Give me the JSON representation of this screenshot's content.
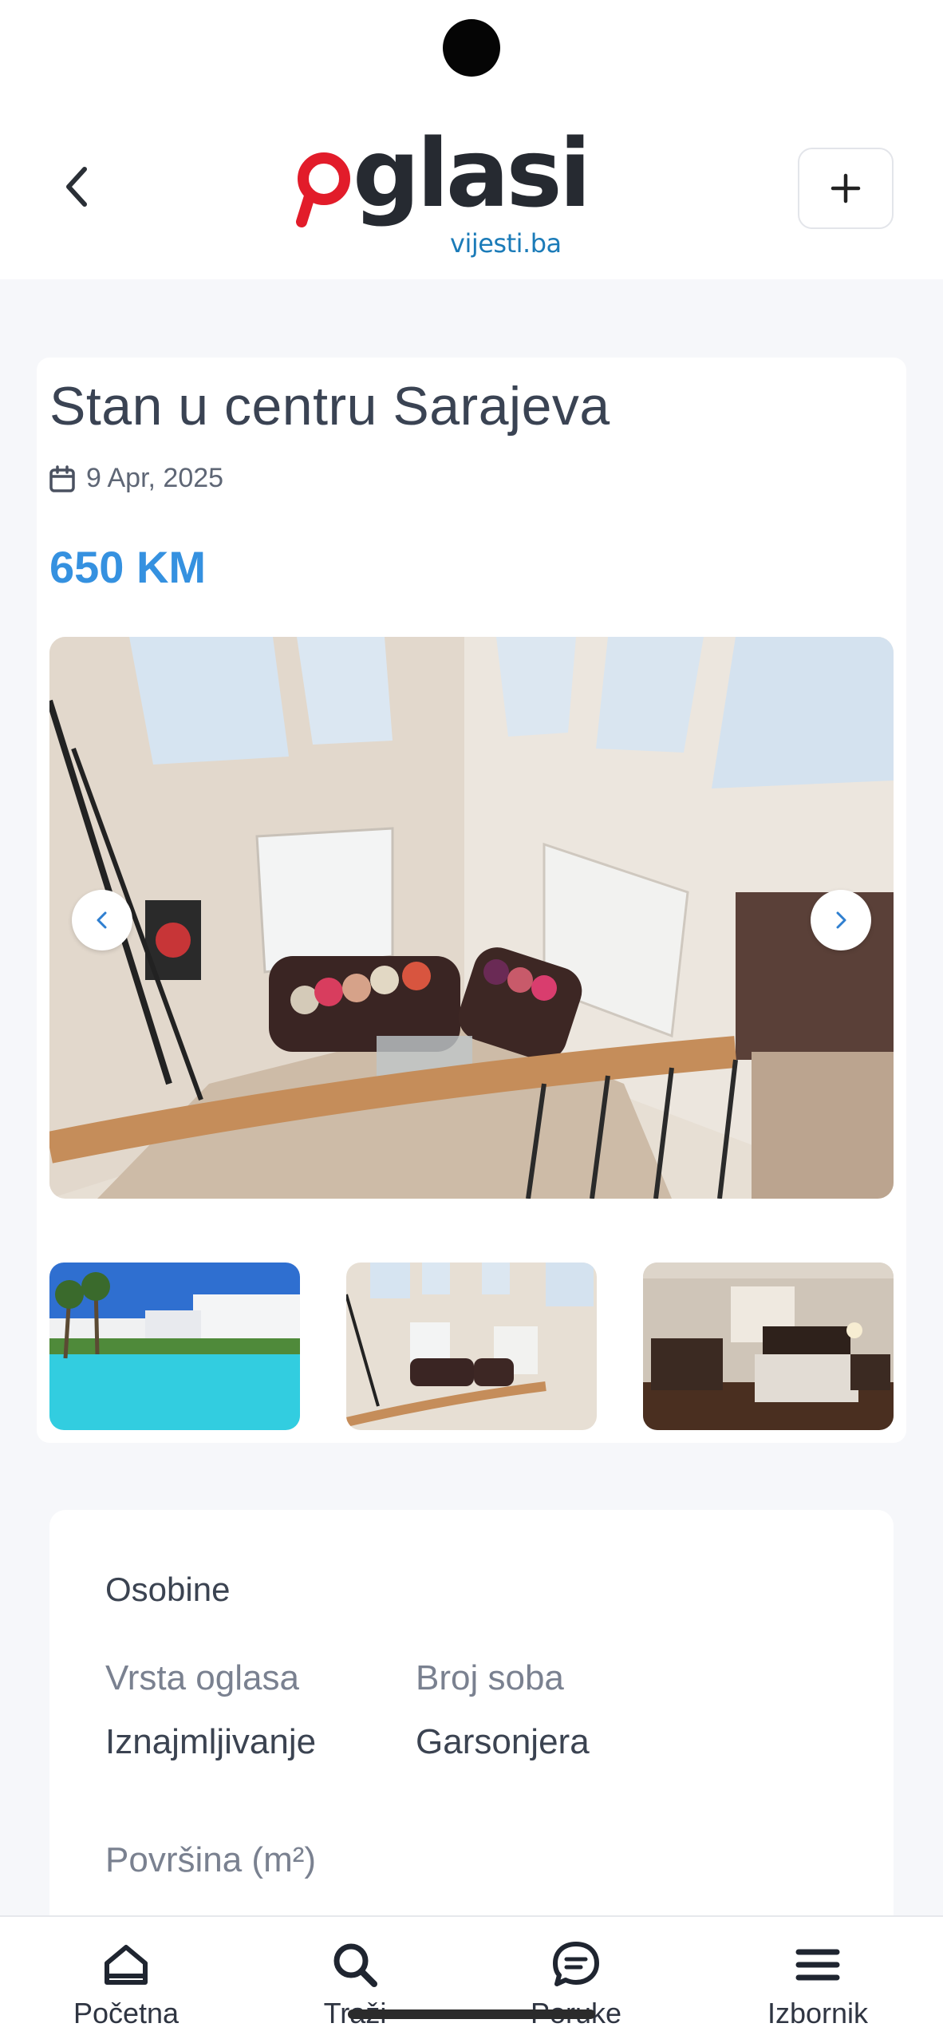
{
  "header": {
    "logo": {
      "main": "oglasi",
      "sub": "vijesti.ba"
    },
    "back_icon": "chevron-left-icon",
    "add_icon": "plus-icon"
  },
  "listing": {
    "title": "Stan u centru Sarajeva",
    "date": "9 Apr, 2025",
    "price": "650 KM",
    "gallery": {
      "main_image": "living-room-photo",
      "prev_icon": "chevron-left-icon",
      "next_icon": "chevron-right-icon",
      "thumbnails": [
        "pool-resort-photo",
        "living-room-photo",
        "bedroom-photo"
      ]
    }
  },
  "features": {
    "title": "Osobine",
    "items": [
      {
        "label": "Vrsta oglasa",
        "value": "Iznajmljivanje"
      },
      {
        "label": "Broj soba",
        "value": "Garsonjera"
      },
      {
        "label": "Površina (m²)",
        "value": ""
      }
    ]
  },
  "bottom_nav": {
    "items": [
      {
        "label": "Početna",
        "icon": "home-icon"
      },
      {
        "label": "Traži",
        "icon": "search-icon"
      },
      {
        "label": "Poruke",
        "icon": "chat-icon"
      },
      {
        "label": "Izbornik",
        "icon": "menu-icon"
      }
    ]
  },
  "colors": {
    "accent": "#3591e0",
    "logo_red": "#e21c2a",
    "logo_blue": "#1b7bb8",
    "background": "#f6f7fa"
  }
}
